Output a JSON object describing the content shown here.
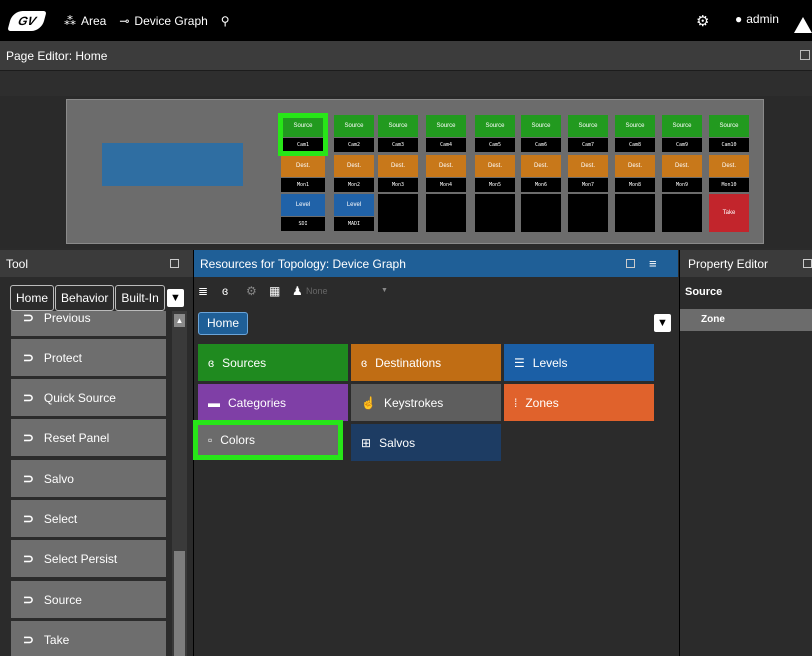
{
  "topbar": {
    "logo": "GV",
    "area_label": "Area",
    "device_graph_label": "Device Graph",
    "user": "admin"
  },
  "page_editor": {
    "title": "Page Editor: Home",
    "panel": {
      "sources": [
        "Source",
        "Source",
        "Source",
        "Source",
        "Source",
        "Source",
        "Source",
        "Source",
        "Source",
        "Source"
      ],
      "cams": [
        "Cam1",
        "Cam2",
        "Cam3",
        "Cam4",
        "Cam5",
        "Cam6",
        "Cam7",
        "Cam8",
        "Cam9",
        "Cam10"
      ],
      "dests": [
        "Dest.",
        "Dest.",
        "Dest.",
        "Dest.",
        "Dest.",
        "Dest.",
        "Dest.",
        "Dest.",
        "Dest.",
        "Dest."
      ],
      "mons": [
        "Mon1",
        "Mon2",
        "Mon3",
        "Mon4",
        "Mon5",
        "Mon6",
        "Mon7",
        "Mon8",
        "Mon9",
        "Mon10"
      ],
      "level1": "Level",
      "level2": "Level",
      "sdi": "SDI",
      "madi": "MADI",
      "take": "Take"
    }
  },
  "tool": {
    "title": "Tool",
    "breadcrumb": [
      "Home",
      "Behavior",
      "Built-In"
    ],
    "items": [
      "Previous",
      "Protect",
      "Quick Source",
      "Reset Panel",
      "Salvo",
      "Select",
      "Select Persist",
      "Source",
      "Take"
    ]
  },
  "resources": {
    "title": "Resources for Topology: Device Graph",
    "none_placeholder": "None",
    "home": "Home",
    "buttons": {
      "sources": "Sources",
      "destinations": "Destinations",
      "levels": "Levels",
      "categories": "Categories",
      "keystrokes": "Keystrokes",
      "zones": "Zones",
      "colors": "Colors",
      "salvos": "Salvos"
    },
    "colors": {
      "sources": "#1f8a1f",
      "destinations": "#c06d14",
      "levels": "#1b5fa6",
      "categories": "#7f3fa6",
      "keystrokes": "#5e5e5e",
      "zones": "#e0622c",
      "colors": "#6b6b6b",
      "salvos": "#1d3c63"
    }
  },
  "property": {
    "title": "Property Editor",
    "section": "Source",
    "field": "Zone"
  }
}
